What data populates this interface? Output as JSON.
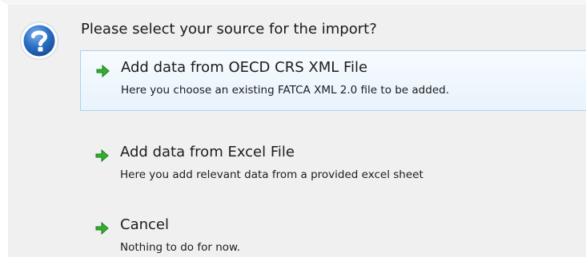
{
  "dialog": {
    "icon": "question-icon",
    "prompt": "Please select your source for the import?",
    "accent_color": "#2a6fc4",
    "arrow_color": "#2fb12f",
    "options": [
      {
        "icon": "green-arrow-icon",
        "title": "Add data from OECD CRS XML File",
        "description": "Here you choose an existing FATCA XML 2.0 file to be added."
      },
      {
        "icon": "green-arrow-icon",
        "title": "Add data from Excel File",
        "description": "Here you add relevant data from a provided excel sheet"
      },
      {
        "icon": "green-arrow-icon",
        "title": "Cancel",
        "description": "Nothing to do for now."
      }
    ]
  }
}
